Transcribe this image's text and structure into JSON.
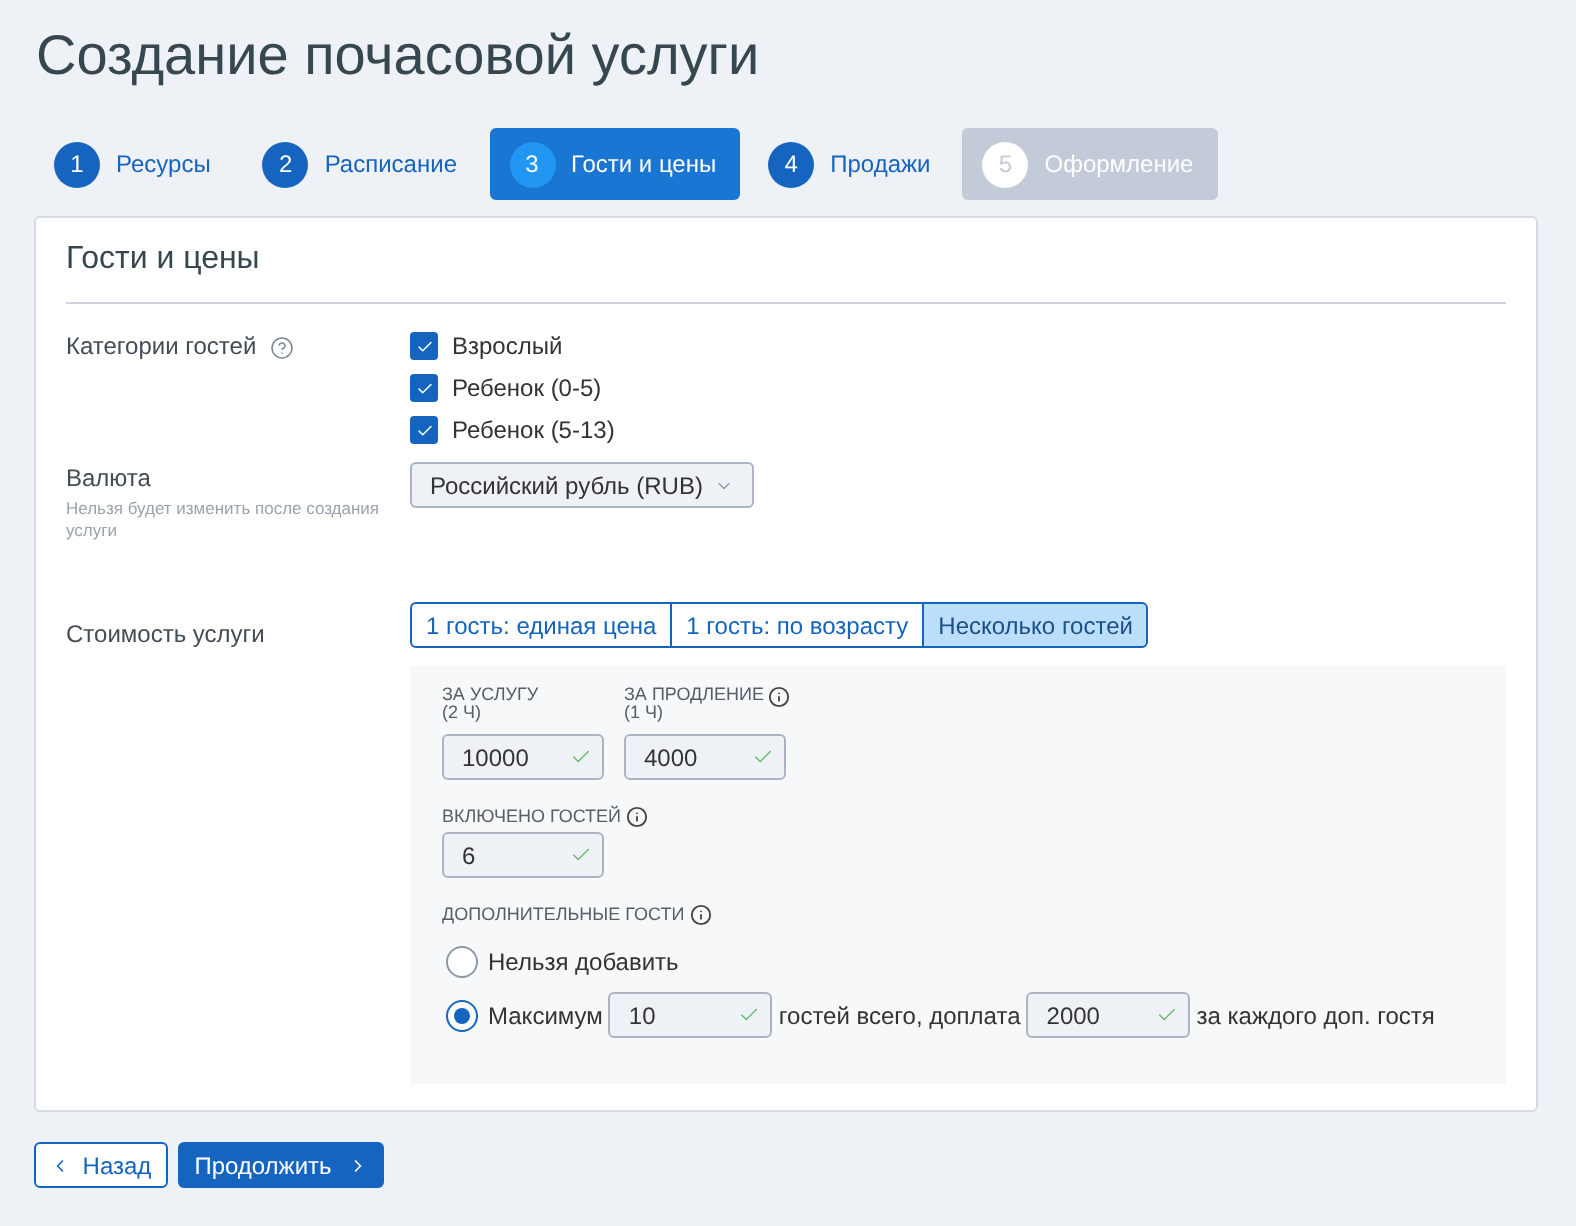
{
  "page": {
    "title": "Создание почасовой услуги"
  },
  "steps": [
    {
      "number": "1",
      "label": "Ресурсы",
      "selected": false,
      "disabled": false
    },
    {
      "number": "2",
      "label": "Расписание",
      "selected": false,
      "disabled": false
    },
    {
      "number": "3",
      "label": "Гости и цены",
      "selected": true,
      "disabled": false
    },
    {
      "number": "4",
      "label": "Продажи",
      "selected": false,
      "disabled": false
    },
    {
      "number": "5",
      "label": "Оформление",
      "selected": false,
      "disabled": true
    }
  ],
  "section": {
    "title": "Гости и цены"
  },
  "guest_categories": {
    "label": "Категории гостей",
    "help": true,
    "items": [
      {
        "label": "Взрослый",
        "checked": true
      },
      {
        "label": "Ребенок (0-5)",
        "checked": true
      },
      {
        "label": "Ребенок (5-13)",
        "checked": true
      }
    ]
  },
  "currency": {
    "label": "Валюта",
    "hint": "Нельзя будет изменить после создания услуги",
    "value": "Российский рубль (RUB)"
  },
  "price": {
    "label": "Стоимость услуги",
    "modes": [
      {
        "label": "1 гость: единая цена",
        "selected": false
      },
      {
        "label": "1 гость: по возрасту",
        "selected": false
      },
      {
        "label": "Несколько гостей",
        "selected": true
      }
    ],
    "fields": [
      {
        "label": "ЗА УСЛУГУ",
        "sublabel": "(2 Ч)",
        "info": false,
        "value": "10000",
        "valid": true
      },
      {
        "label": "ЗА ПРОДЛЕНИЕ",
        "sublabel": "(1 Ч)",
        "info": true,
        "value": "4000",
        "valid": true
      }
    ],
    "included_guests": {
      "label": "ВКЛЮЧЕНО ГОСТЕЙ",
      "info": true,
      "value": "6",
      "valid": true
    },
    "extra_guests": {
      "label": "ДОПОЛНИТЕЛЬНЫЕ ГОСТИ",
      "info": true,
      "options": [
        {
          "kind": "plain",
          "label": "Нельзя добавить",
          "selected": false
        },
        {
          "kind": "maximum",
          "label": "Максимум",
          "max_guests": {
            "value": "10",
            "valid": true
          },
          "text_middle": "гостей всего, доплата",
          "surcharge": {
            "value": "2000",
            "valid": true
          },
          "text_end": "за каждого доп. гостя",
          "selected": true
        }
      ]
    }
  },
  "actions": {
    "back": "Назад",
    "next": "Продолжить"
  }
}
